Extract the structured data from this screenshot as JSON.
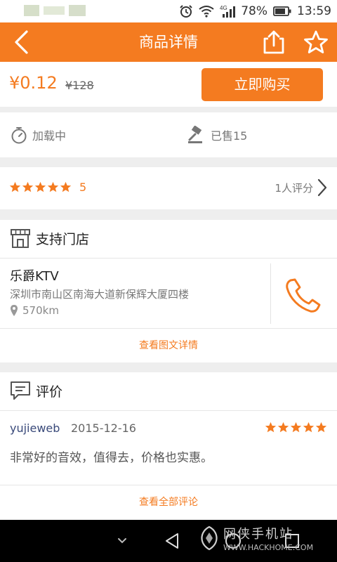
{
  "status_bar": {
    "battery": "78%",
    "time": "13:59",
    "network": "4G"
  },
  "header": {
    "title": "商品详情"
  },
  "price": {
    "current": "¥0.12",
    "original": "¥128",
    "buy_label": "立即购买"
  },
  "stats": {
    "loading": "加载中",
    "sold": "已售15"
  },
  "rating": {
    "stars": 5,
    "score": "5",
    "count_label": "1人评分"
  },
  "store": {
    "section_title": "支持门店",
    "name": "乐爵KTV",
    "address": "深圳市南山区南海大道新保辉大厦四楼",
    "distance": "570km",
    "detail_link": "查看图文详情"
  },
  "reviews": {
    "section_title": "评价",
    "items": [
      {
        "user": "yujieweb",
        "date": "2015-12-16",
        "stars": 5,
        "text": "非常好的音效，值得去，价格也实惠。"
      }
    ],
    "all_link": "查看全部评论"
  },
  "watermark": {
    "title": "网侠手机站",
    "url": "WWW.HACKHOME.COM"
  },
  "colors": {
    "accent": "#f47b20",
    "background": "#eeeeee"
  }
}
